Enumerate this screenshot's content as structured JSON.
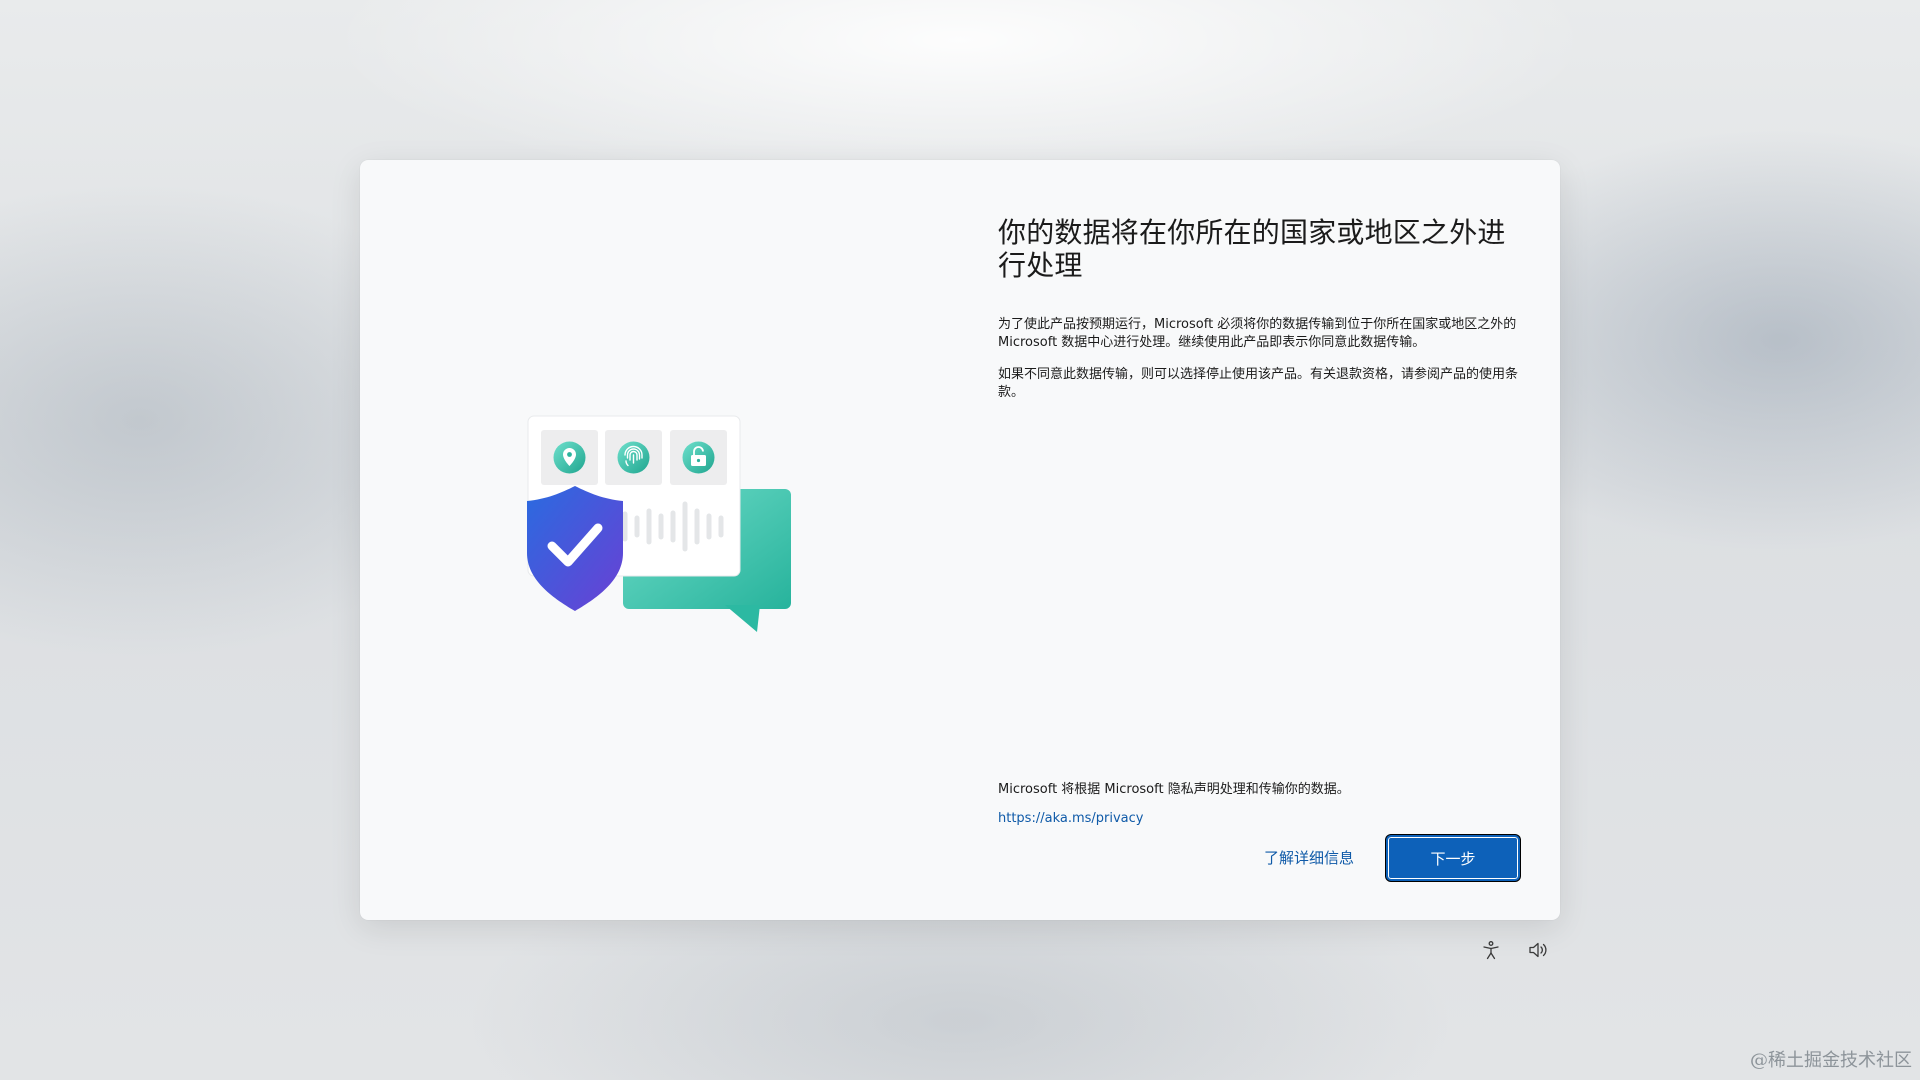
{
  "dialog": {
    "title": "你的数据将在你所在的国家或地区之外进行处理",
    "paragraph_1": "为了使此产品按预期运行，Microsoft 必须将你的数据传输到位于你所在国家或地区之外的 Microsoft 数据中心进行处理。继续使用此产品即表示你同意此数据传输。",
    "paragraph_2": "如果不同意此数据传输，则可以选择停止使用该产品。有关退款资格，请参阅产品的使用条款。",
    "footer_text": "Microsoft 将根据 Microsoft 隐私声明处理和传输你的数据。",
    "privacy_link": "https://aka.ms/privacy",
    "learn_more_label": "了解详细信息",
    "next_button_label": "下一步"
  },
  "illustration_icons": [
    "location-pin-icon",
    "fingerprint-icon",
    "padlock-icon",
    "shield-check-icon",
    "sound-wave-icon",
    "chat-bubble-icon"
  ],
  "system_icons": [
    "accessibility-icon",
    "volume-icon"
  ],
  "colors": {
    "accent": "#0d61b9",
    "link": "#0f5aa8",
    "teal": "#3cc4b0",
    "shield_blue": "#2d5fd8",
    "shield_purple": "#6a44d6"
  },
  "watermark": "@稀土掘金技术社区"
}
